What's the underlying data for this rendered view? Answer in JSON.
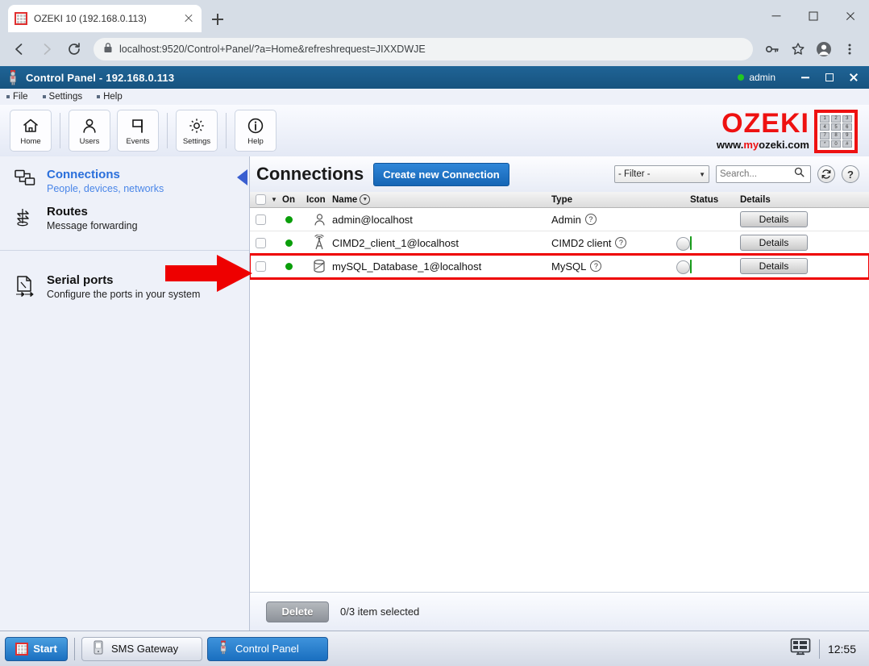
{
  "browser": {
    "tab": {
      "title": "OZEKI 10 (192.168.0.113)",
      "favicon": "ozeki-grid-icon",
      "close": "close-icon"
    },
    "new_tab": "+",
    "url": "localhost:9520/Control+Panel/?a=Home&refreshrequest=JIXXDWJE",
    "nav": {
      "back": "back-arrow-icon",
      "forward": "forward-arrow-icon",
      "reload": "reload-icon",
      "lock": "lock-icon"
    },
    "actions": {
      "key": "password-key-icon",
      "star": "bookmark-star-icon",
      "profile": "profile-avatar-icon",
      "menu": "kebab-menu-icon"
    },
    "window_controls": {
      "minimize": "minimize-icon",
      "maximize": "maximize-icon",
      "close": "close-icon"
    }
  },
  "app": {
    "title": "Control Panel - 192.168.0.113",
    "user": "admin",
    "user_status_color": "#22c722",
    "window_controls": {
      "minimize": "minimize-icon",
      "maximize": "maximize-icon",
      "close": "close-icon"
    },
    "menu": [
      {
        "label": "File"
      },
      {
        "label": "Settings"
      },
      {
        "label": "Help"
      }
    ],
    "toolbar": [
      {
        "label": "Home",
        "icon": "home-icon"
      },
      {
        "label": "Users",
        "icon": "user-icon"
      },
      {
        "label": "Events",
        "icon": "flag-icon"
      },
      {
        "label": "Settings",
        "icon": "gear-icon"
      },
      {
        "label": "Help",
        "icon": "info-icon"
      }
    ],
    "logo": {
      "word": "OZEKI",
      "url_prefix": "www.",
      "url_my": "my",
      "url_suffix": "ozeki.com",
      "keypad": [
        "1",
        "2",
        "3",
        "4",
        "5",
        "6",
        "7",
        "8",
        "9",
        "*",
        "0",
        "#"
      ],
      "color": "#ee1111"
    }
  },
  "sidebar": {
    "groups": [
      {
        "items": [
          {
            "title": "Connections",
            "subtitle": "People, devices, networks",
            "icon": "network-devices-icon",
            "active": true
          },
          {
            "title": "Routes",
            "subtitle": "Message forwarding",
            "icon": "routes-arrows-icon",
            "active": false
          }
        ]
      },
      {
        "items": [
          {
            "title": "Serial ports",
            "subtitle": "Configure the ports in your system",
            "icon": "serial-port-icon",
            "active": false
          }
        ]
      }
    ],
    "pointer": "collapse-triangle-icon"
  },
  "main": {
    "title": "Connections",
    "create_button": "Create new Connection",
    "filter": {
      "value": "- Filter -",
      "caret": "chevron-down-icon"
    },
    "search": {
      "value": "",
      "placeholder": "Search...",
      "icon": "search-icon"
    },
    "refresh_icon": "refresh-icon",
    "help_icon": "question-mark-icon",
    "table": {
      "headers": {
        "select_all": "select-all-checkbox",
        "caret": "chevron-down-icon",
        "on": "On",
        "icon": "Icon",
        "name": "Name",
        "name_sort": "sort-chevron-icon",
        "type": "Type",
        "status": "Status",
        "details": "Details"
      },
      "rows": [
        {
          "on": true,
          "icon": "user-icon",
          "name": "admin@localhost",
          "type": "Admin",
          "type_help": "?",
          "has_toggle": false,
          "toggle_on": false,
          "details": "Details",
          "highlighted": false
        },
        {
          "on": true,
          "icon": "antenna-tower-icon",
          "name": "CIMD2_client_1@localhost",
          "type": "CIMD2 client",
          "type_help": "?",
          "has_toggle": true,
          "toggle_on": true,
          "details": "Details",
          "highlighted": false
        },
        {
          "on": true,
          "icon": "database-cylinder-icon",
          "name": "mySQL_Database_1@localhost",
          "type": "MySQL",
          "type_help": "?",
          "has_toggle": true,
          "toggle_on": true,
          "details": "Details",
          "highlighted": true
        }
      ]
    },
    "footer": {
      "delete_button": "Delete",
      "selection_text": "0/3 item selected"
    }
  },
  "annotation": {
    "arrow": "red-pointer-arrow",
    "arrow_color": "#ee0000",
    "highlight_color": "#ee0000"
  },
  "taskbar": {
    "start": "Start",
    "items": [
      {
        "label": "SMS Gateway",
        "icon": "phone-icon",
        "active": false
      },
      {
        "label": "Control Panel",
        "icon": "ozeki-person-icon",
        "active": true
      }
    ],
    "tray_icon": "display-monitor-icon",
    "clock": "12:55"
  }
}
